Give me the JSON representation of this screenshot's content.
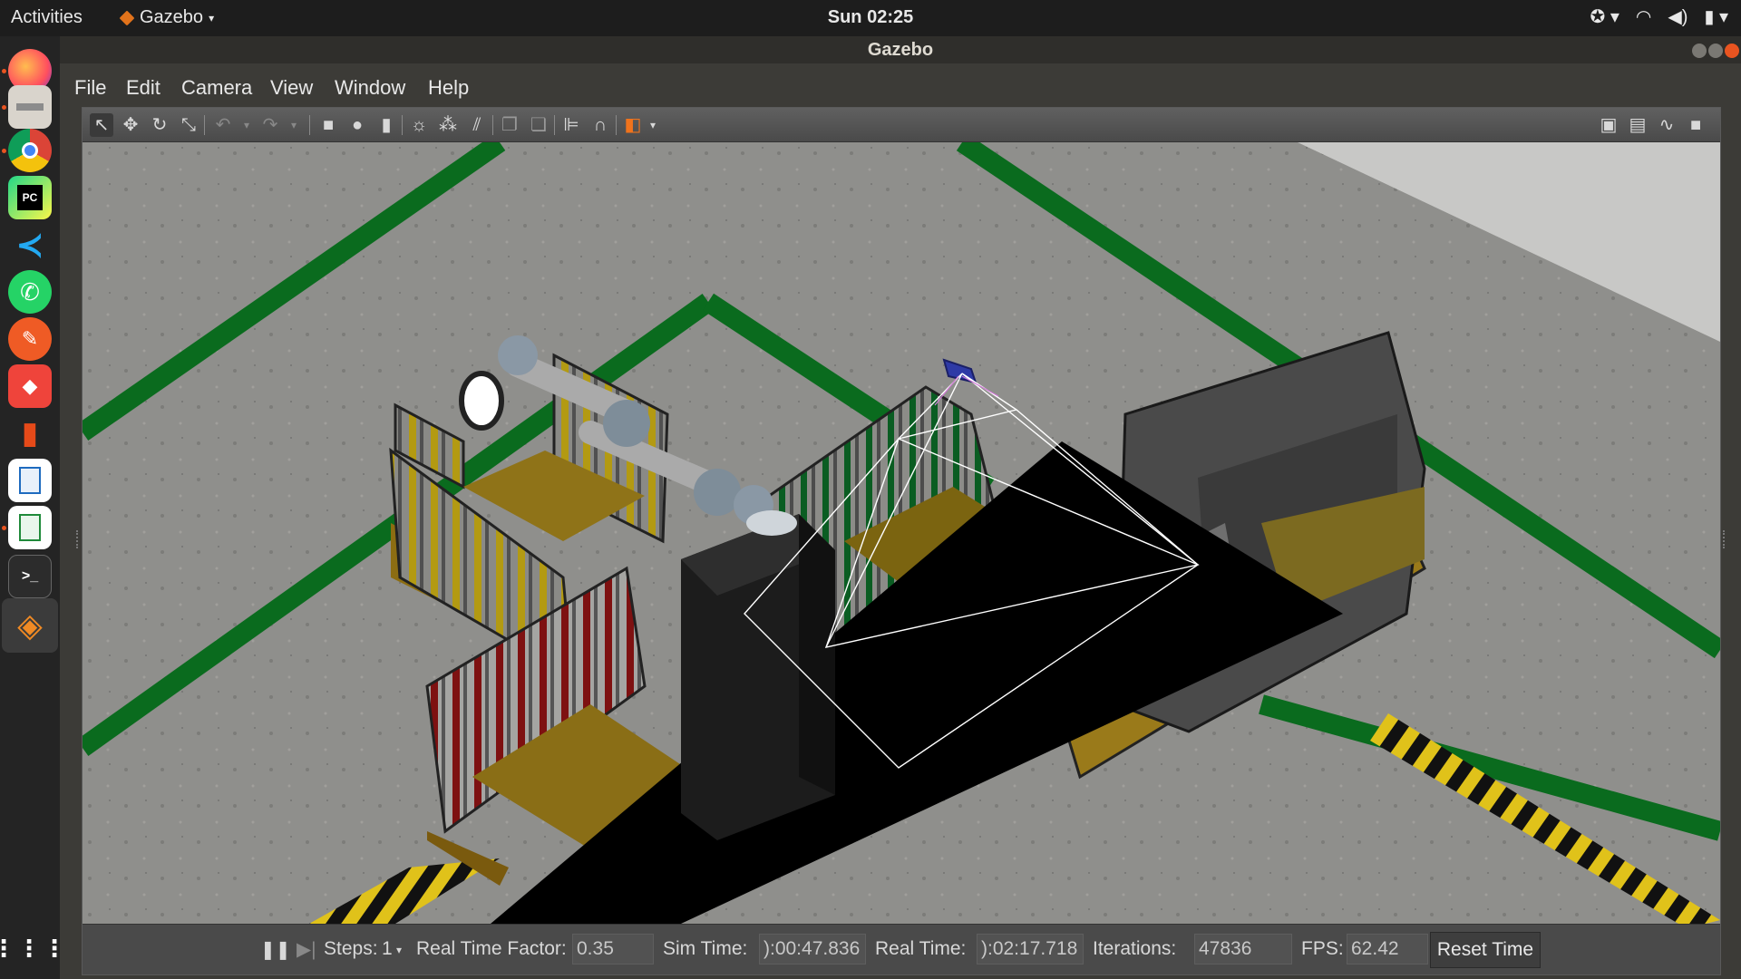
{
  "topbar": {
    "activities": "Activities",
    "app_name": "Gazebo",
    "clock": "Sun 02:25",
    "tray_icons": [
      "accessibility-icon",
      "wifi-icon",
      "volume-icon",
      "battery-icon"
    ]
  },
  "dock": {
    "items": [
      "firefox",
      "files",
      "chrome",
      "pycharm",
      "vscode",
      "whatsapp",
      "postman",
      "anydesk",
      "office",
      "writer",
      "calc",
      "terminal",
      "gazebo"
    ],
    "show_apps": "show-applications-icon"
  },
  "window": {
    "title": "Gazebo",
    "menu": [
      "File",
      "Edit",
      "Camera",
      "View",
      "Window",
      "Help"
    ]
  },
  "toolbar": {
    "tools": [
      "select-icon",
      "translate-icon",
      "rotate-icon",
      "scale-icon",
      "undo-icon",
      "redo-icon",
      "box-icon",
      "sphere-icon",
      "cylinder-icon",
      "point-light-icon",
      "spot-light-icon",
      "directional-light-icon",
      "copy-icon",
      "paste-icon",
      "align-icon",
      "snap-icon",
      "view-angle-icon"
    ],
    "right_tools": [
      "screenshot-icon",
      "log-icon",
      "plot-icon",
      "record-icon"
    ]
  },
  "status": {
    "steps_label": "Steps:",
    "steps_value": "1",
    "rtf_label": "Real Time Factor:",
    "rtf_value": "0.35",
    "sim_label": "Sim Time:",
    "sim_value": "):00:47.836",
    "real_label": "Real Time:",
    "real_value": "):02:17.718",
    "iter_label": "Iterations:",
    "iter_value": "47836",
    "fps_label": "FPS:",
    "fps_value": "62.42",
    "reset_label": "Reset Time"
  },
  "colors": {
    "accent": "#e95420",
    "floor": "#8d8d8a",
    "stripe_green": "#0a6b1e",
    "conveyor": "#000000"
  }
}
